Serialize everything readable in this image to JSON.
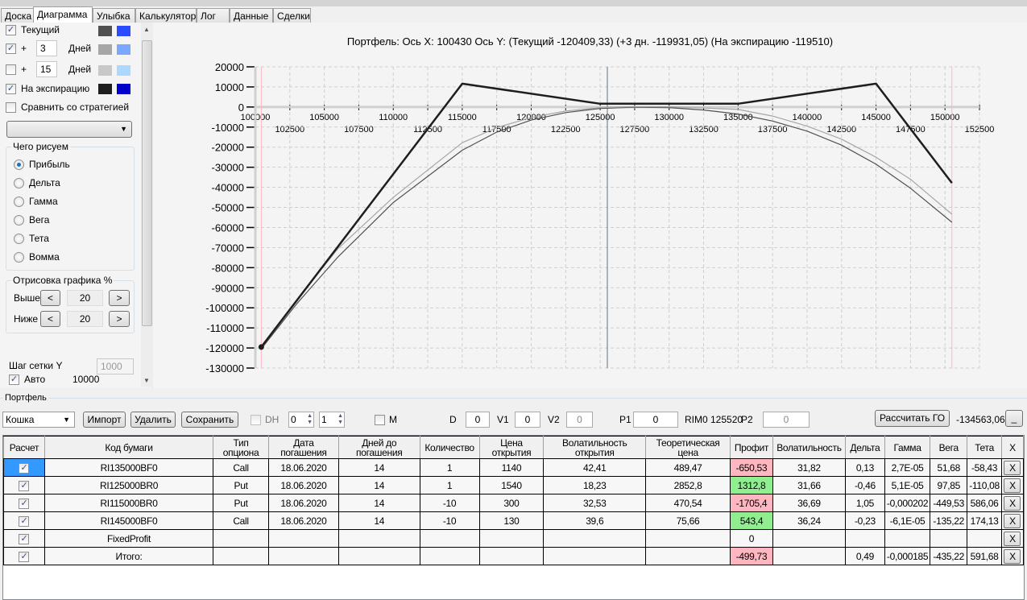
{
  "tabs": [
    "Доска",
    "Диаграмма",
    "Улыбка",
    "Калькулятор",
    "Лог",
    "Данные",
    "Сделки"
  ],
  "active_tab": "Диаграмма",
  "left": {
    "current": {
      "label": "Текущий",
      "checked": true,
      "colors": [
        "#505050",
        "#2a4bff"
      ]
    },
    "plus1": {
      "plus": "+",
      "days": "3",
      "days_label": "Дней",
      "checked": true,
      "colors": [
        "#a6a6a6",
        "#7aa7ff"
      ]
    },
    "plus2": {
      "plus": "+",
      "days": "15",
      "days_label": "Дней",
      "checked": false,
      "colors": [
        "#c8c8c8",
        "#aad8ff"
      ]
    },
    "expiration": {
      "label": "На экспирацию",
      "checked": true,
      "colors": [
        "#1e1e1e",
        "#0000c8"
      ]
    },
    "compare": {
      "label": "Сравнить со стратегией",
      "checked": false
    },
    "strategy_select": "",
    "draw_group": {
      "title": "Чего рисуем",
      "options": [
        "Прибыль",
        "Дельта",
        "Гамма",
        "Вега",
        "Тета",
        "Вомма"
      ],
      "selected": "Прибыль"
    },
    "range_group": {
      "title": "Отрисовка графика %",
      "above_label": "Выше",
      "above": "20",
      "below_label": "Ниже",
      "below": "20",
      "dec": "<",
      "inc": ">"
    },
    "grid_step": {
      "label": "Шаг сетки Y",
      "value": "1000",
      "auto_label": "Авто",
      "auto_checked": true,
      "auto_value": "10000"
    }
  },
  "chart_data": {
    "type": "line",
    "title": "Портфель: Ось X:  100430 Ось Y:  (Текущий -120409,33)  (+3 дн. -119931,05)  (На экспирацию -119510)",
    "xlim": [
      100000,
      152500
    ],
    "ylim": [
      -130000,
      20000
    ],
    "x_ticks": [
      100000,
      102500,
      105000,
      107500,
      110000,
      112500,
      115000,
      117500,
      120000,
      122500,
      125000,
      127500,
      130000,
      132500,
      135000,
      137500,
      140000,
      142500,
      145000,
      147500,
      150000,
      152500
    ],
    "y_ticks": [
      20000,
      10000,
      0,
      -10000,
      -20000,
      -30000,
      -40000,
      -50000,
      -60000,
      -70000,
      -80000,
      -90000,
      -100000,
      -110000,
      -120000,
      -130000
    ],
    "grid": true,
    "vertical_markers": [
      {
        "x": 100430,
        "color": "#ffb6c1"
      },
      {
        "x": 150500,
        "color": "#ffb6c1"
      },
      {
        "x": 125520,
        "color": "#607080"
      }
    ],
    "series": [
      {
        "name": "Текущий",
        "color": "#505050",
        "width": 1.2,
        "x": [
          100430,
          103000,
          106000,
          110000,
          115000,
          117500,
          120000,
          122500,
          125000,
          127500,
          130000,
          132500,
          135000,
          137500,
          140000,
          142500,
          145000,
          147500,
          150500
        ],
        "y": [
          -120409,
          -98000,
          -74600,
          -47600,
          -21500,
          -12500,
          -6500,
          -2800,
          -700,
          -100,
          -300,
          -1500,
          -3500,
          -7000,
          -12000,
          -19000,
          -28500,
          -40500,
          -57400
        ]
      },
      {
        "name": "+3 дн.",
        "color": "#a6a6a6",
        "width": 1.2,
        "x": [
          100430,
          103000,
          106000,
          110000,
          115000,
          117500,
          120000,
          122500,
          125000,
          127500,
          130000,
          132500,
          135000,
          137500,
          140000,
          142500,
          145000,
          147500,
          150500
        ],
        "y": [
          -119931,
          -96000,
          -70500,
          -45000,
          -17800,
          -10300,
          -5200,
          -2000,
          -300,
          200,
          100,
          -500,
          -1200,
          -4500,
          -9500,
          -16000,
          -25000,
          -36000,
          -53400
        ]
      },
      {
        "name": "На экспирацию",
        "color": "#1e1e1e",
        "width": 2.5,
        "x": [
          100430,
          115000,
          125000,
          135000,
          145000,
          150500
        ],
        "y": [
          -119510,
          11620,
          1620,
          1620,
          11620,
          -37880
        ]
      }
    ]
  },
  "portfolio": {
    "title": "Портфель",
    "name": "Кошка",
    "import": "Импорт",
    "delete": "Удалить",
    "save": "Сохранить",
    "dh_label": "DH",
    "spin1": "0",
    "spin2": "1",
    "m_label": "M",
    "d_label": "D",
    "d": "0",
    "v1_label": "V1",
    "v1": "0",
    "v2_label": "V2",
    "v2": "0",
    "p1_label": "P1",
    "p1": "0",
    "rim": "RIM0 125520",
    "p2_label": "P2",
    "p2": "0",
    "calc_go": "Рассчитать ГО",
    "go_value": "-134563,06",
    "min_btn": "_"
  },
  "table": {
    "headers": [
      "Расчет",
      "Код бумаги",
      "Тип опциона",
      "Дата погашения",
      "Дней до погашения",
      "Количество",
      "Цена открытия",
      "Волатильность открытия",
      "Теоретическая цена",
      "Профит",
      "Волатильность",
      "Дельта",
      "Гамма",
      "Вега",
      "Тета",
      "X"
    ],
    "colors": {
      "loss": "#ffb6c1",
      "gain": "#90ee90",
      "selected": "#3399ff"
    },
    "rows": [
      {
        "cells": [
          "RI135000BF0",
          "Call",
          "18.06.2020",
          "14",
          "1",
          "1140",
          "42,41",
          "489,47",
          "-650,53",
          "31,82",
          "0,13",
          "2,7E-05",
          "51,68",
          "-58,43"
        ],
        "profit": "loss"
      },
      {
        "cells": [
          "RI125000BR0",
          "Put",
          "18.06.2020",
          "14",
          "1",
          "1540",
          "18,23",
          "2852,8",
          "1312,8",
          "31,66",
          "-0,46",
          "5,1E-05",
          "97,85",
          "-110,08"
        ],
        "profit": "gain"
      },
      {
        "cells": [
          "RI115000BR0",
          "Put",
          "18.06.2020",
          "14",
          "-10",
          "300",
          "32,53",
          "470,54",
          "-1705,4",
          "36,69",
          "1,05",
          "-0,000202",
          "-449,53",
          "586,06"
        ],
        "profit": "loss"
      },
      {
        "cells": [
          "RI145000BF0",
          "Call",
          "18.06.2020",
          "14",
          "-10",
          "130",
          "39,6",
          "75,66",
          "543,4",
          "36,24",
          "-0,23",
          "-6,1E-05",
          "-135,22",
          "174,13"
        ],
        "profit": "gain"
      },
      {
        "cells": [
          "FixedProfit",
          "",
          "",
          "",
          "",
          "",
          "",
          "",
          "0",
          "",
          "",
          "",
          "",
          ""
        ],
        "profit": ""
      },
      {
        "cells": [
          "Итого:",
          "",
          "",
          "",
          "",
          "",
          "",
          "",
          "-499,73",
          "",
          "0,49",
          "-0,000185",
          "-435,22",
          "591,68"
        ],
        "profit": "loss"
      }
    ],
    "remove_label": "X"
  }
}
